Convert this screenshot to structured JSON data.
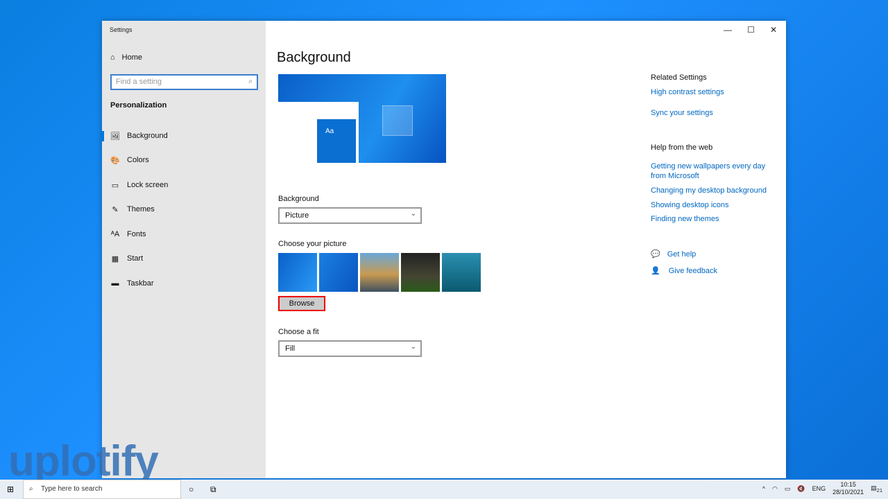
{
  "window": {
    "title": "Settings",
    "min": "—",
    "max": "☐",
    "close": "✕"
  },
  "sidebar": {
    "home": "Home",
    "search_placeholder": "Find a setting",
    "section": "Personalization",
    "items": [
      {
        "label": "Background",
        "icon": "🖼"
      },
      {
        "label": "Colors",
        "icon": "🎨"
      },
      {
        "label": "Lock screen",
        "icon": "▭"
      },
      {
        "label": "Themes",
        "icon": "✎"
      },
      {
        "label": "Fonts",
        "icon": "ᴬA"
      },
      {
        "label": "Start",
        "icon": "▦"
      },
      {
        "label": "Taskbar",
        "icon": "▬"
      }
    ]
  },
  "main": {
    "title": "Background",
    "preview_tile": "Aa",
    "background_label": "Background",
    "background_value": "Picture",
    "choose_picture": "Choose your picture",
    "browse": "Browse",
    "fit_label": "Choose a fit",
    "fit_value": "Fill"
  },
  "related": {
    "heading": "Related Settings",
    "links": [
      "High contrast settings",
      "Sync your settings"
    ],
    "help_heading": "Help from the web",
    "help_links": [
      "Getting new wallpapers every day",
      "from Microsoft",
      "Changing my desktop background",
      "Showing desktop icons",
      "Finding new themes"
    ],
    "get_help": "Get help",
    "feedback": "Give feedback"
  },
  "taskbar": {
    "search": "Type here to search",
    "lang": "ENG",
    "time": "10:15",
    "date": "28/10/2021",
    "notifications": "21"
  },
  "watermark": "uplotify"
}
